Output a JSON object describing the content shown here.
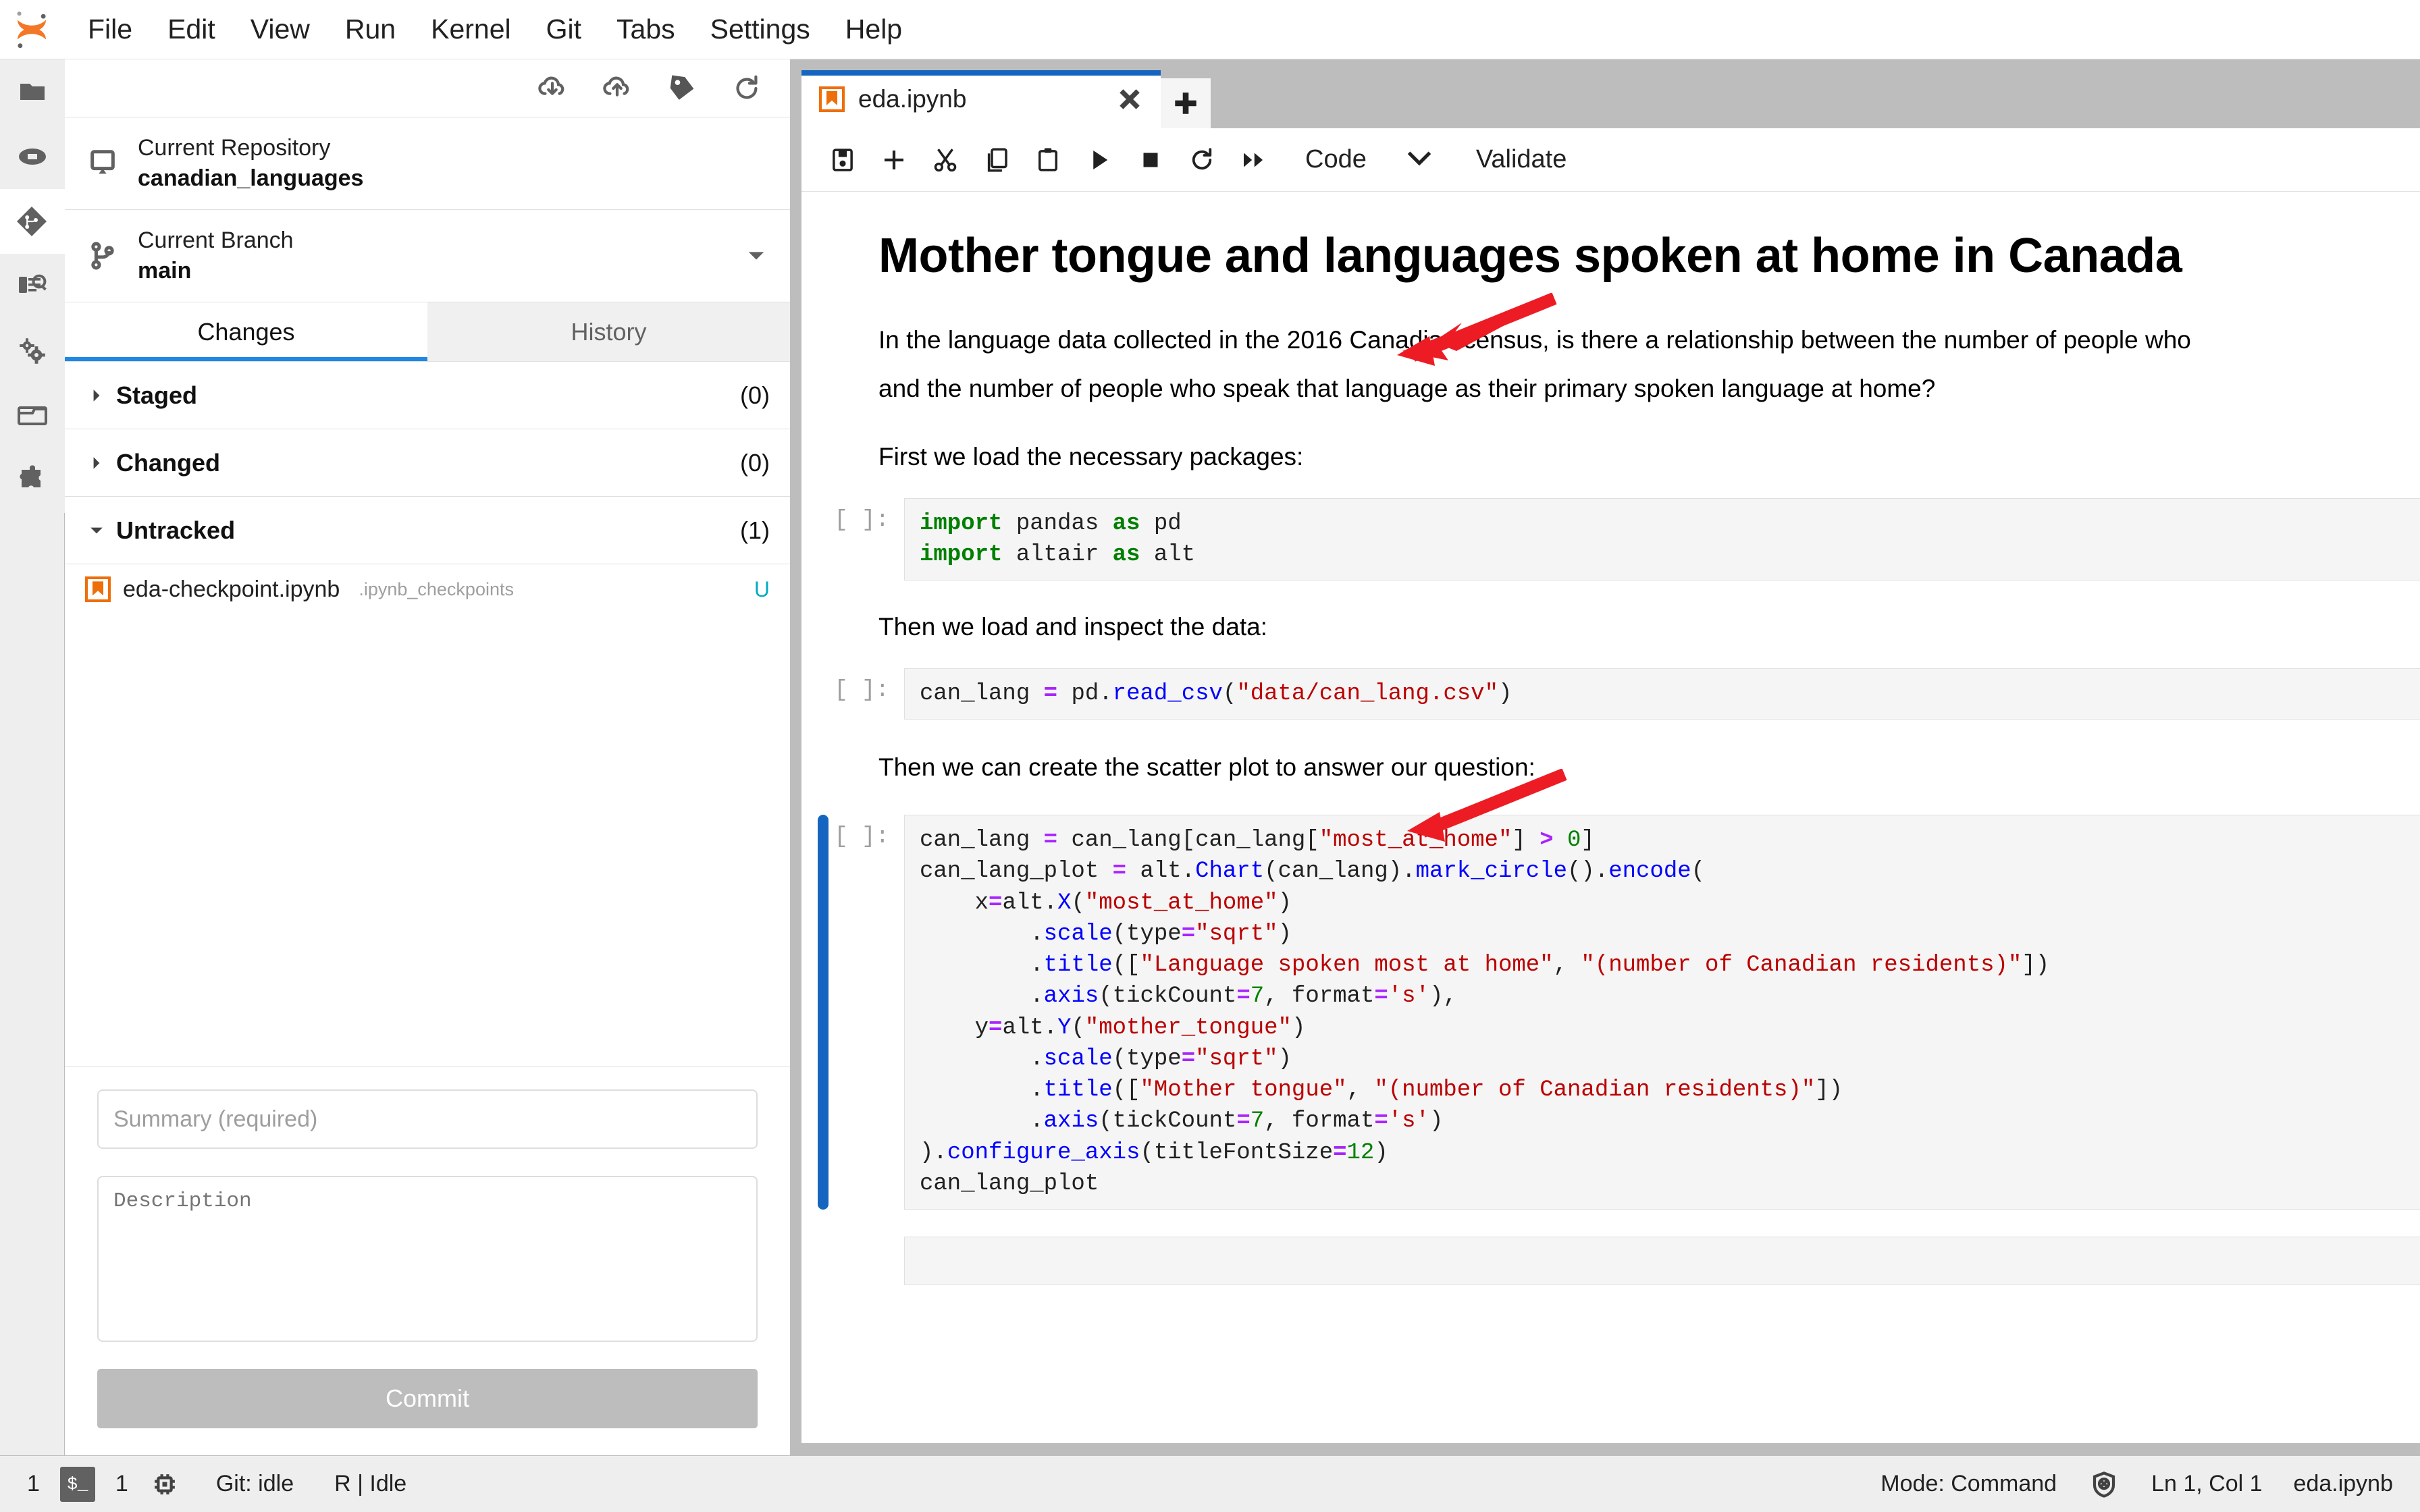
{
  "menubar": {
    "logo": "jupyter-logo",
    "items": [
      "File",
      "Edit",
      "View",
      "Run",
      "Kernel",
      "Git",
      "Tabs",
      "Settings",
      "Help"
    ]
  },
  "activity_bar": {
    "items": [
      {
        "name": "file-browser-icon",
        "title": "File Browser",
        "selected": false
      },
      {
        "name": "running-terminals-icon",
        "title": "Running Terminals and Kernels",
        "selected": false
      },
      {
        "name": "git-icon",
        "title": "Git",
        "selected": true
      },
      {
        "name": "commands-icon",
        "title": "Commands",
        "selected": false
      },
      {
        "name": "property-inspector-icon",
        "title": "Property Inspector",
        "selected": false
      },
      {
        "name": "open-tabs-icon",
        "title": "Open Tabs",
        "selected": false
      },
      {
        "name": "extension-manager-icon",
        "title": "Extension Manager",
        "selected": false
      }
    ]
  },
  "git_panel": {
    "toolbar": [
      {
        "name": "pull-icon",
        "title": "Pull from remote"
      },
      {
        "name": "push-icon",
        "title": "Push to remote"
      },
      {
        "name": "tag-icon",
        "title": "Tag"
      },
      {
        "name": "refresh-icon",
        "title": "Refresh"
      }
    ],
    "repository": {
      "label": "Current Repository",
      "value": "canadian_languages"
    },
    "branch": {
      "label": "Current Branch",
      "value": "main"
    },
    "tabs": [
      {
        "label": "Changes",
        "active": true
      },
      {
        "label": "History",
        "active": false
      }
    ],
    "groups": [
      {
        "name": "Staged",
        "count": "(0)",
        "expanded": false
      },
      {
        "name": "Changed",
        "count": "(0)",
        "expanded": false
      },
      {
        "name": "Untracked",
        "count": "(1)",
        "expanded": true
      }
    ],
    "untracked_files": [
      {
        "filename": "eda-checkpoint.ipynb",
        "directory": ".ipynb_checkpoints",
        "status": "U"
      }
    ],
    "commit": {
      "summary_placeholder": "Summary (required)",
      "summary_value": "",
      "description_placeholder": "Description",
      "description_value": "",
      "button_label": "Commit"
    }
  },
  "notebook": {
    "tab": {
      "title": "eda.ipynb",
      "icon": "notebook-icon"
    },
    "add_tab_label": "+",
    "toolbar": {
      "buttons": [
        {
          "name": "save-icon",
          "title": "Save"
        },
        {
          "name": "insert-cell-icon",
          "title": "Insert cell below"
        },
        {
          "name": "cut-icon",
          "title": "Cut cells"
        },
        {
          "name": "copy-icon",
          "title": "Copy cells"
        },
        {
          "name": "paste-icon",
          "title": "Paste cells"
        },
        {
          "name": "run-icon",
          "title": "Run cell"
        },
        {
          "name": "stop-icon",
          "title": "Interrupt kernel"
        },
        {
          "name": "restart-icon",
          "title": "Restart kernel"
        },
        {
          "name": "restart-run-all-icon",
          "title": "Restart and run all"
        }
      ],
      "cell_type": "Code",
      "cell_type_caret": "chevron-down-icon",
      "validate_label": "Validate"
    },
    "cells": [
      {
        "type": "markdown",
        "heading": "Mother tongue and languages spoken at home in Canada",
        "paragraphs": [
          "In the language data collected in the 2016 Canadian census, is there a relationship between the number of people who",
          "and the number of people who speak that language as their primary spoken language at home?",
          "First we load the necessary packages:"
        ]
      },
      {
        "type": "code",
        "prompt": "[ ]:",
        "selected": false,
        "lines": [
          "import pandas as pd",
          "import altair as alt"
        ]
      },
      {
        "type": "markdown",
        "paragraphs": [
          "Then we load and inspect the data:"
        ]
      },
      {
        "type": "code",
        "prompt": "[ ]:",
        "selected": false,
        "lines": [
          "can_lang = pd.read_csv(\"data/can_lang.csv\")"
        ]
      },
      {
        "type": "markdown",
        "paragraphs": [
          "Then we can create the scatter plot to answer our question:"
        ]
      },
      {
        "type": "code",
        "prompt": "[ ]:",
        "selected": true,
        "lines": [
          "can_lang = can_lang[can_lang[\"most_at_home\"] > 0]",
          "can_lang_plot = alt.Chart(can_lang).mark_circle().encode(",
          "    x=alt.X(\"most_at_home\")",
          "        .scale(type=\"sqrt\")",
          "        .title([\"Language spoken most at home\", \"(number of Canadian residents)\"])",
          "        .axis(tickCount=7, format='s'),",
          "    y=alt.Y(\"mother_tongue\")",
          "        .scale(type=\"sqrt\")",
          "        .title([\"Mother tongue\", \"(number of Canadian residents)\"])",
          "        .axis(tickCount=7, format='s')",
          ").configure_axis(titleFontSize=12)",
          "can_lang_plot"
        ]
      },
      {
        "type": "code",
        "prompt": "",
        "selected": false,
        "lines": [
          ""
        ]
      }
    ],
    "annotations": [
      {
        "name": "red-arrow-x-scale",
        "color": "#ED1C24",
        "points_at": ".scale(type=\"sqrt\")"
      },
      {
        "name": "red-arrow-y-scale",
        "color": "#ED1C24",
        "points_at": ".scale(type=\"sqrt\")"
      }
    ]
  },
  "statusbar": {
    "terminal_count": "1",
    "terminal_icon": "terminal-icon",
    "kernel_count": "1",
    "kernel_icon": "kernel-icon",
    "git_status": "Git: idle",
    "kernel_status": "R | Idle",
    "mode": "Mode: Command",
    "trust_icon": "not-trusted-icon",
    "cursor_position": "Ln 1, Col 1",
    "filename": "eda.ipynb"
  },
  "colors": {
    "accent_blue": "#1e88e5",
    "tab_blue": "#1565c0",
    "jupyter_orange": "#f37726",
    "annotation_red": "#ED1C24",
    "untracked_teal": "#00acc1"
  }
}
